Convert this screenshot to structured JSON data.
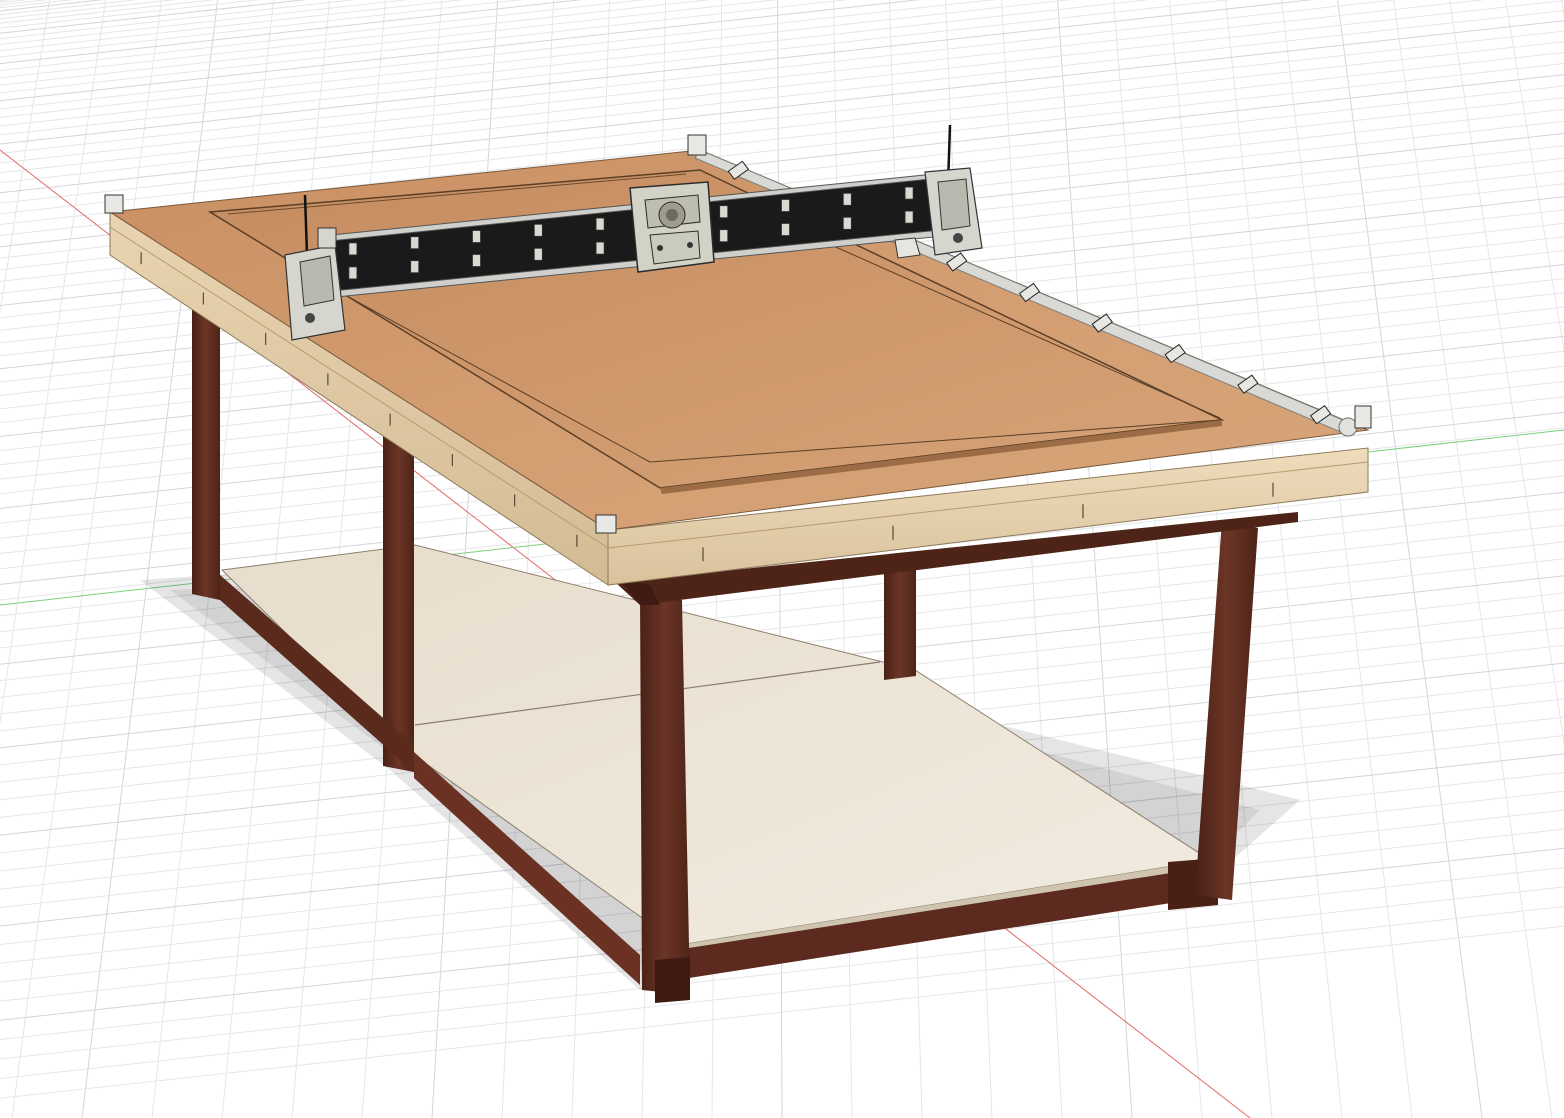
{
  "viewport": {
    "background": "#ffffff",
    "grid_color": "#d2d5d9",
    "grid_minor_color": "#e4e6e9",
    "axis_x_color": "#e06a6a",
    "axis_y_color": "#7ccf7c"
  },
  "model": {
    "parts": [
      "table-top",
      "spoilboard",
      "gantry",
      "router-carriage",
      "side-rail-left",
      "side-rail-right",
      "legs",
      "lower-frame",
      "lower-shelf"
    ],
    "colors": {
      "top": "#d09a6e",
      "spoilboard": "#c79165",
      "edge": "#e6d2b0",
      "leg": "#5e2c1f",
      "leg_dark": "#3f1b13",
      "shelf": "#ece4d6",
      "gantry": "#1e1e1e",
      "carriage": "#cfcfc1",
      "rail": "#d8d8d8"
    }
  }
}
